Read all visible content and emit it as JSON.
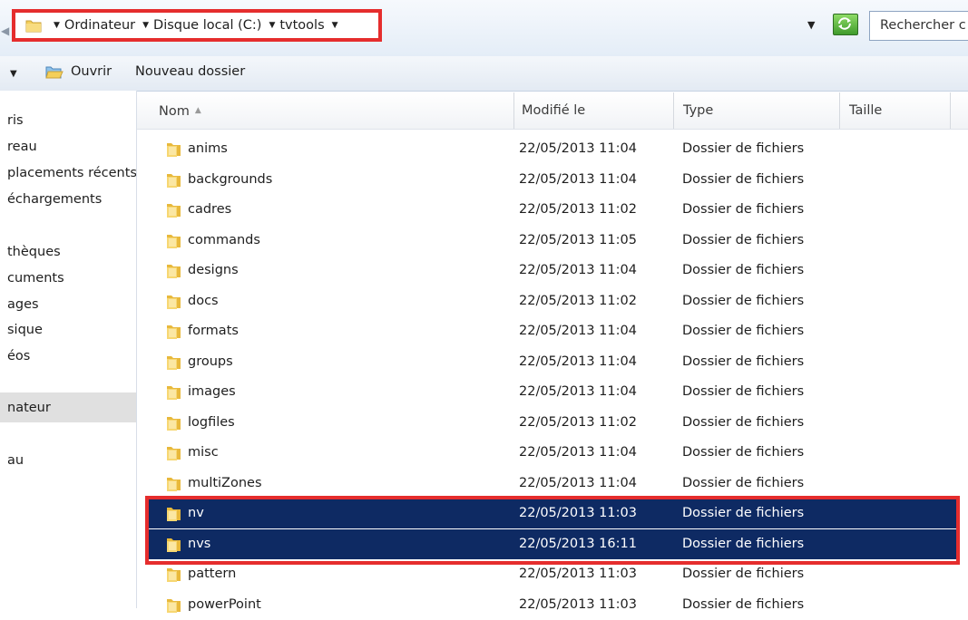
{
  "address_bar": {
    "breadcrumbs": [
      "Ordinateur",
      "Disque local (C:)",
      "tvtools"
    ],
    "search_placeholder": "Rechercher c"
  },
  "toolbar": {
    "open_label": "Ouvrir",
    "new_folder_label": "Nouveau dossier"
  },
  "nav": {
    "items": [
      {
        "label": "ris"
      },
      {
        "label": "reau"
      },
      {
        "label": "placements récents"
      },
      {
        "label": "échargements"
      },
      {
        "label": "thèques"
      },
      {
        "label": "cuments"
      },
      {
        "label": "ages"
      },
      {
        "label": "sique"
      },
      {
        "label": "éos"
      },
      {
        "label": "nateur"
      },
      {
        "label": "au"
      }
    ],
    "selected_item": "nateur"
  },
  "columns": {
    "name": "Nom",
    "modified": "Modifié le",
    "type": "Type",
    "size": "Taille"
  },
  "files": [
    {
      "name": "anims",
      "modified": "22/05/2013 11:04",
      "type": "Dossier de fichiers",
      "selected": false
    },
    {
      "name": "backgrounds",
      "modified": "22/05/2013 11:04",
      "type": "Dossier de fichiers",
      "selected": false
    },
    {
      "name": "cadres",
      "modified": "22/05/2013 11:02",
      "type": "Dossier de fichiers",
      "selected": false
    },
    {
      "name": "commands",
      "modified": "22/05/2013 11:05",
      "type": "Dossier de fichiers",
      "selected": false
    },
    {
      "name": "designs",
      "modified": "22/05/2013 11:04",
      "type": "Dossier de fichiers",
      "selected": false
    },
    {
      "name": "docs",
      "modified": "22/05/2013 11:02",
      "type": "Dossier de fichiers",
      "selected": false
    },
    {
      "name": "formats",
      "modified": "22/05/2013 11:04",
      "type": "Dossier de fichiers",
      "selected": false
    },
    {
      "name": "groups",
      "modified": "22/05/2013 11:04",
      "type": "Dossier de fichiers",
      "selected": false
    },
    {
      "name": "images",
      "modified": "22/05/2013 11:04",
      "type": "Dossier de fichiers",
      "selected": false
    },
    {
      "name": "logfiles",
      "modified": "22/05/2013 11:02",
      "type": "Dossier de fichiers",
      "selected": false
    },
    {
      "name": "misc",
      "modified": "22/05/2013 11:04",
      "type": "Dossier de fichiers",
      "selected": false
    },
    {
      "name": "multiZones",
      "modified": "22/05/2013 11:04",
      "type": "Dossier de fichiers",
      "selected": false
    },
    {
      "name": "nv",
      "modified": "22/05/2013 11:03",
      "type": "Dossier de fichiers",
      "selected": true
    },
    {
      "name": "nvs",
      "modified": "22/05/2013 16:11",
      "type": "Dossier de fichiers",
      "selected": true
    },
    {
      "name": "pattern",
      "modified": "22/05/2013 11:03",
      "type": "Dossier de fichiers",
      "selected": false
    },
    {
      "name": "powerPoint",
      "modified": "22/05/2013 11:03",
      "type": "Dossier de fichiers",
      "selected": false
    }
  ],
  "colors": {
    "selection_bg": "#0e2a63",
    "highlight_border": "#e52d2d",
    "folder_yellow": "#f4cf5a"
  }
}
